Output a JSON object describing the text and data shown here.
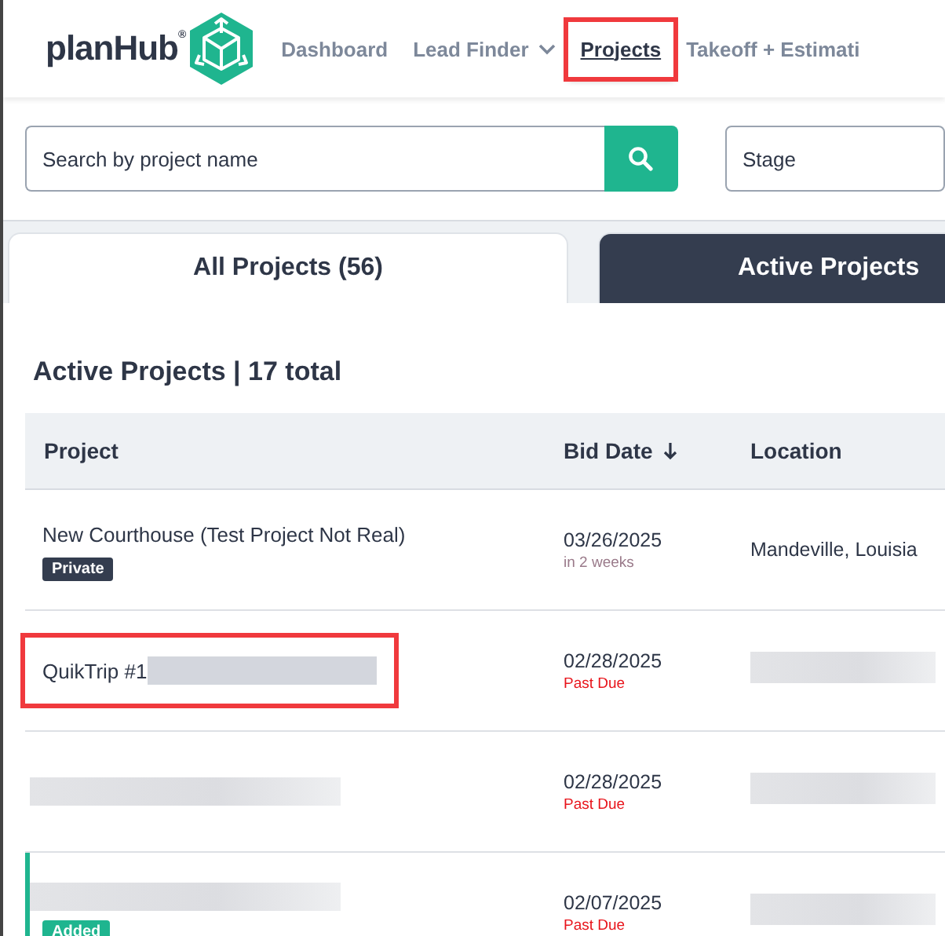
{
  "logo": {
    "text": "planHub$^{®}$"
  },
  "nav": [
    {
      "label": "Dashboard",
      "selected": false,
      "dropdown": false,
      "highlighted": false
    },
    {
      "label": "Lead Finder",
      "selected": false,
      "dropdown": true,
      "highlighted": false
    },
    {
      "label": "Projects",
      "selected": true,
      "dropdown": false,
      "highlighted": true
    },
    {
      "label": "Takeoff + Estimati",
      "selected": false,
      "dropdown": false,
      "highlighted": false
    }
  ],
  "search": {
    "placeholder": "Search by project name"
  },
  "stage_filter": {
    "placeholder": "Stage"
  },
  "tabs": [
    {
      "label": "All Projects (56)",
      "selected": false
    },
    {
      "label": "Active Projects",
      "selected": true
    }
  ],
  "table": {
    "title": "Active Projects | 17 total",
    "columns": [
      {
        "label": "Project",
        "sorted": false
      },
      {
        "label": "Bid Date",
        "sorted": true
      },
      {
        "label": "Location",
        "sorted": false
      }
    ],
    "rows": [
      {
        "project": "New Courthouse (Test Project Not Real)",
        "badge": {
          "label": "Private",
          "kind": "private"
        },
        "highlighted": false,
        "accent": false,
        "bid_date": "03/26/2025",
        "due": "in 2 weeks",
        "overdue": false,
        "location": "Mandeville, Louisia"
      },
      {
        "project": "QuikTrip #1",
        "project_redacted": true,
        "highlighted": true,
        "accent": false,
        "bid_date": "02/28/2025",
        "due": "Past Due",
        "overdue": true,
        "location_redacted": true
      },
      {
        "project_redacted": true,
        "highlighted": false,
        "accent": false,
        "bid_date": "02/28/2025",
        "due": "Past Due",
        "overdue": true,
        "location_redacted": true
      },
      {
        "project_redacted": true,
        "badge": {
          "label": "Added",
          "kind": "added"
        },
        "highlighted": false,
        "accent": true,
        "bid_date": "02/07/2025",
        "due": "Past Due",
        "overdue": true,
        "location_redacted": true
      }
    ]
  }
}
